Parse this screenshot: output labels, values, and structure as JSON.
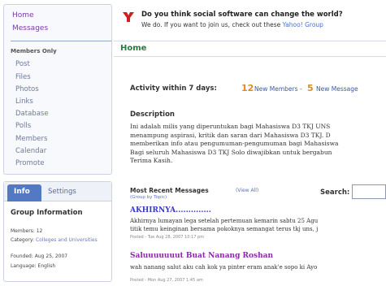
{
  "sidebar": {
    "top_links": [
      "Home",
      "Messages"
    ],
    "members_only_label": "Members Only",
    "members_items": [
      "Post",
      "Files",
      "Photos",
      "Links",
      "Database",
      "Polls",
      "Members",
      "Calendar",
      "Promote"
    ],
    "info_box": {
      "tab_active": "Info",
      "tab_settings": "Settings",
      "title": "Group Information",
      "members": "Members: 12",
      "category_label": "Category:",
      "category_value": "Colleges and Universities",
      "founded": "Founded: Aug 25, 2007",
      "language": "Language: English"
    }
  },
  "banner": {
    "question": "Do you think social software can change the world?",
    "sub_text": "We do. If you want to join us, check out these",
    "sub_link": "Yahoo! Group"
  },
  "main": {
    "page_title": "Home",
    "activity_label": "Activity within 7 days:",
    "new_members_count": "12",
    "new_members_label": "New Members",
    "new_messages_count": "5",
    "new_messages_label": "New Message",
    "description_title": "Description",
    "description_lines": [
      "Ini adalah milis yang diperuntukan bagi Mahasiswa D3 TKJ UNS",
      "menampung aspirasi, kritik dan saran dari Mahasiswa D3 TKJ. D",
      "memberikan info atau pengumuman-pengumuman bagi Mahasiswa",
      "Bagi seluruh Mahasiswa D3 TKJ Solo diwajibkan untuk bergabun",
      "Terima Kasih."
    ],
    "recent_title": "Most Recent Messages",
    "view_all": "(View All)",
    "group_by_topic": "(Group by Topic)",
    "search_label": "Search:",
    "search_value": "",
    "messages": [
      {
        "title": "AKHIRNYA..............",
        "body_lines": [
          "Akhirnya lumayan lega setelah pertemuan kemarin sabtu 25 Agu",
          "titik temu keinginan bersama pokoknya semangat terus tkj uns, j"
        ],
        "meta": "Posted - Tue Aug 28, 2007 10:17 pm"
      },
      {
        "title": "Saluuuuuuut Buat Nanang Roshan",
        "body_lines": [
          "wah nanang salut aku cah kok ya pinter eram anak'e sopo ki Ayo"
        ],
        "meta": "Posted - Mon Aug 27, 2007 1:45 am"
      }
    ]
  },
  "colors": {
    "accent_green": "#2a7a3f",
    "count_orange": "#e08a1c",
    "message_title_blue": "#3a3ac8",
    "message_title_purple": "#8a2aa8",
    "info_tab_blue": "#5479c3"
  },
  "icons": {
    "logo": "yahoo-y-logo-icon"
  }
}
